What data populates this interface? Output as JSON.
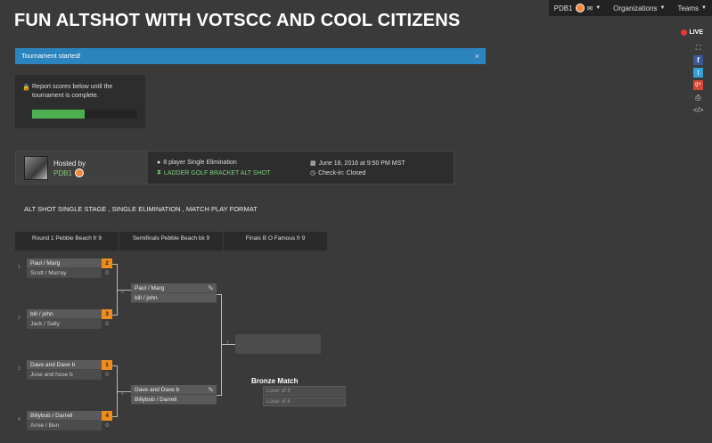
{
  "nav": {
    "user": "PDB1",
    "organizations": "Organizations",
    "teams": "Teams"
  },
  "title": "FUN ALTSHOT WITH VOTSCC AND COOL CITIZENS",
  "live_label": "LIVE",
  "share_icons": [
    "fullscreen-icon",
    "facebook-icon",
    "twitter-icon",
    "google-plus-icon",
    "print-icon",
    "embed-icon"
  ],
  "alert": {
    "text": "Tournament started!",
    "close": "×"
  },
  "report": {
    "text": "Report scores below until the tournament is complete.",
    "progress_fraction": 0.5
  },
  "host": {
    "label": "Hosted by",
    "user": "PDB1",
    "format": "8 player Single Elimination",
    "game": "LADDER GOLF BRACKET ALT SHOT",
    "date": "June 18, 2016 at 9:50 PM MST",
    "checkin": "Check-in: Closed"
  },
  "description": "ALT SHOT SINGLE STAGE , SINGLE ELIMINATION , MATCH PLAY FORMAT",
  "rounds": [
    "Round 1 Pebble Beach fr 9",
    "Semifinals Pebble Beach bk 9",
    "Finals B O Famous fr 9"
  ],
  "round1": [
    {
      "num": "1",
      "p1": "Paul / Marg",
      "s1": "2",
      "p2": "Scott / Murray",
      "s2": "0"
    },
    {
      "num": "2",
      "p1": "bill / john",
      "s1": "3",
      "p2": "Jack / Sally",
      "s2": "0"
    },
    {
      "num": "3",
      "p1": "Dave and Dave b",
      "s1": "1",
      "p2": "Jose and hose b",
      "s2": "0"
    },
    {
      "num": "4",
      "p1": "Billybob / Darrell",
      "s1": "4",
      "p2": "Arnie / Ben",
      "s2": "0"
    }
  ],
  "semis": [
    {
      "num": "5",
      "p1": "Paul / Marg",
      "p2": "bill / john"
    },
    {
      "num": "6",
      "p1": "Dave and Dave b",
      "p2": "Billybob / Darrell"
    }
  ],
  "final": {
    "num": "7"
  },
  "bronze": {
    "title": "Bronze Match",
    "slot1": "Loser of 5",
    "slot2": "Loser of 6"
  }
}
